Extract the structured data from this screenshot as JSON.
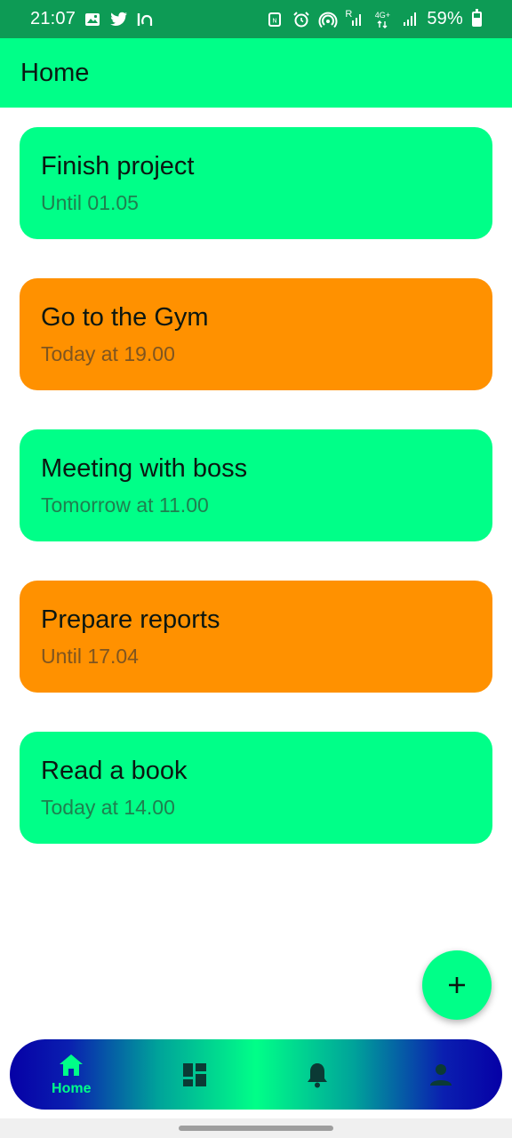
{
  "status_bar": {
    "time": "21:07",
    "battery_percent": "59%",
    "left_icons": [
      "gallery-icon",
      "twitter-icon",
      "la-app-icon"
    ],
    "right_icons": [
      "nfc-icon",
      "alarm-icon",
      "hotspot-icon",
      "signal-r-icon",
      "data-4g-icon",
      "signal-icon",
      "battery-icon"
    ],
    "sig_r": "R",
    "sig_4g": "4G+"
  },
  "app_bar": {
    "title": "Home"
  },
  "tasks": [
    {
      "title": "Finish project",
      "subtitle": "Until 01.05",
      "color": "#00ff88"
    },
    {
      "title": "Go to the Gym",
      "subtitle": "Today at 19.00",
      "color": "#ff9100"
    },
    {
      "title": "Meeting with boss",
      "subtitle": "Tomorrow at 11.00",
      "color": "#00ff88"
    },
    {
      "title": "Prepare reports",
      "subtitle": "Until 17.04",
      "color": "#ff9100"
    },
    {
      "title": "Read a book",
      "subtitle": "Today at 14.00",
      "color": "#00ff88"
    }
  ],
  "fab": {
    "icon": "plus-icon"
  },
  "bottom_nav": {
    "items": [
      {
        "label": "Home",
        "icon": "home-icon",
        "selected": true
      },
      {
        "label": "",
        "icon": "dashboard-icon",
        "selected": false
      },
      {
        "label": "",
        "icon": "bell-icon",
        "selected": false
      },
      {
        "label": "",
        "icon": "person-icon",
        "selected": false
      }
    ],
    "selected_color": "#00ff88",
    "icon_color": "#0b3a35"
  }
}
